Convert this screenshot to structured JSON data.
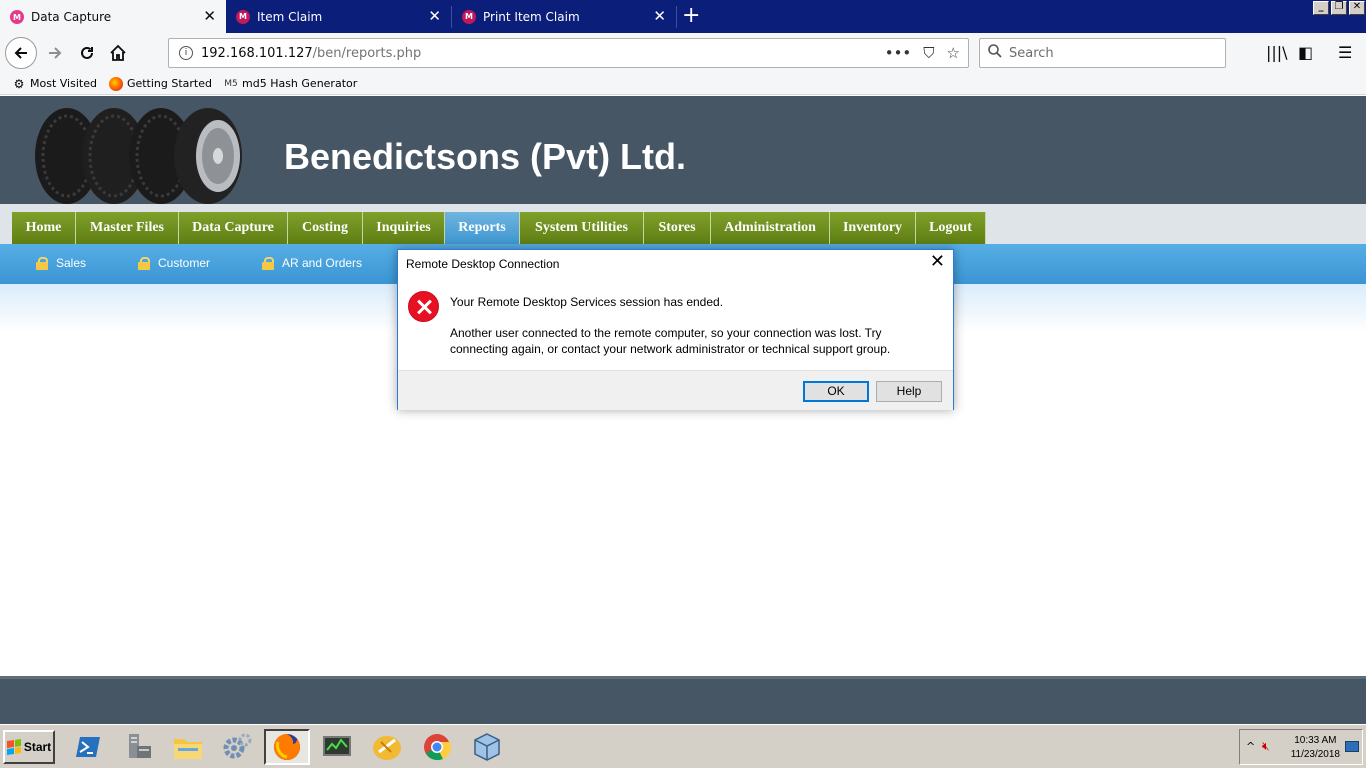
{
  "browser": {
    "tabs": [
      {
        "title": "Data Capture",
        "active": true
      },
      {
        "title": "Item Claim",
        "active": false
      },
      {
        "title": "Print Item Claim",
        "active": false
      }
    ],
    "new_tab_label": "+",
    "url_host": "192.168.101.127",
    "url_path": "/ben/reports.php",
    "search_placeholder": "Search",
    "bookmarks": [
      "Most Visited",
      "Getting Started",
      "md5 Hash Generator"
    ]
  },
  "site": {
    "title": "Benedictsons (Pvt) Ltd.",
    "menu": [
      "Home",
      "Master Files",
      "Data Capture",
      "Costing",
      "Inquiries",
      "Reports",
      "System Utilities",
      "Stores",
      "Administration",
      "Inventory",
      "Logout"
    ],
    "active_menu": "Reports",
    "submenu": [
      "Sales",
      "Customer",
      "AR and Orders"
    ]
  },
  "dialog": {
    "title": "Remote Desktop Connection",
    "message": "Your Remote Desktop Services session has ended.",
    "detail": "Another user connected to the remote computer, so your connection was lost. Try connecting again, or contact your network administrator or technical support group.",
    "ok_label": "OK",
    "help_label": "Help"
  },
  "taskbar": {
    "start_label": "Start",
    "apps": [
      "powershell-icon",
      "server-manager-icon",
      "file-explorer-icon",
      "settings-icon",
      "firefox-icon",
      "network-monitor-icon",
      "filezilla-icon",
      "chrome-icon",
      "virtualbox-icon"
    ],
    "time": "10:33 AM",
    "date": "11/23/2018"
  },
  "colors": {
    "tabstrip": "#0a1e7a",
    "header": "#465665",
    "menu_green": "#6b8c1c",
    "menu_active": "#4aa3db",
    "error_red": "#e81123"
  }
}
